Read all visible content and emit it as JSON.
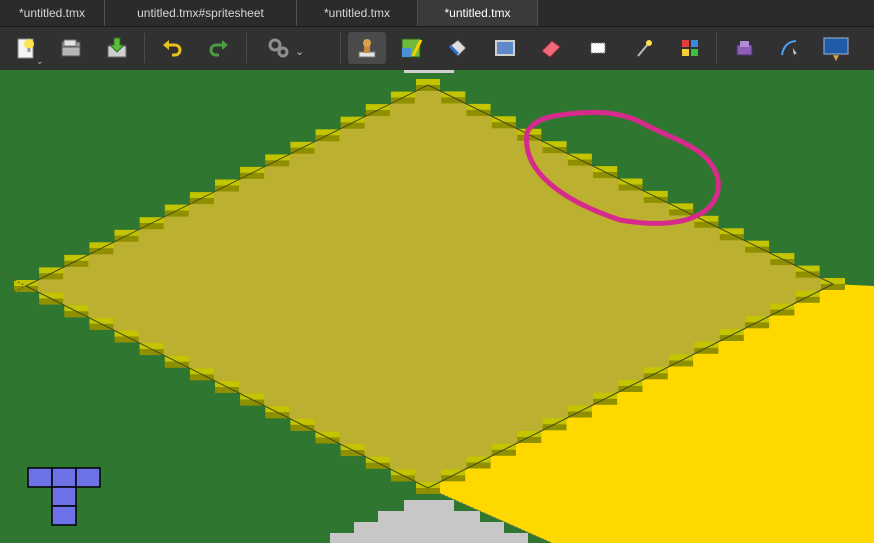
{
  "tabs": [
    {
      "label": "*untitled.tmx",
      "active": false
    },
    {
      "label": "untitled.tmx#spritesheet",
      "active": false
    },
    {
      "label": "*untitled.tmx",
      "active": false
    },
    {
      "label": "*untitled.tmx",
      "active": true
    }
  ],
  "toolbar": {
    "tools": [
      {
        "icon": "new-map-icon"
      },
      {
        "icon": "open-file-icon"
      },
      {
        "icon": "save-file-icon"
      },
      {
        "icon": "undo-icon"
      },
      {
        "icon": "redo-icon"
      },
      {
        "icon": "commands-icon"
      },
      {
        "icon": "stamp-brush-icon",
        "selected": true
      },
      {
        "icon": "terrain-brush-icon"
      },
      {
        "icon": "bucket-fill-icon"
      },
      {
        "icon": "shape-fill-icon"
      },
      {
        "icon": "eraser-icon"
      },
      {
        "icon": "rectangle-select-icon"
      },
      {
        "icon": "magic-wand-icon"
      },
      {
        "icon": "select-same-tile-icon"
      },
      {
        "icon": "insert-tile-icon"
      },
      {
        "icon": "edit-polygons-icon"
      },
      {
        "icon": "tile-layer-icon"
      }
    ]
  },
  "colors": {
    "background_grass": "#2f7731",
    "selection_fill": "#bcb030",
    "selection_edge": "#c4c400",
    "selection_edge_dark": "#8f8f00",
    "yellow_tiles": "#ffd800",
    "gray_tiles": "#c7c7c7",
    "annotation_stroke": "#d62a8c",
    "brush_preview": "#6d73e6"
  }
}
